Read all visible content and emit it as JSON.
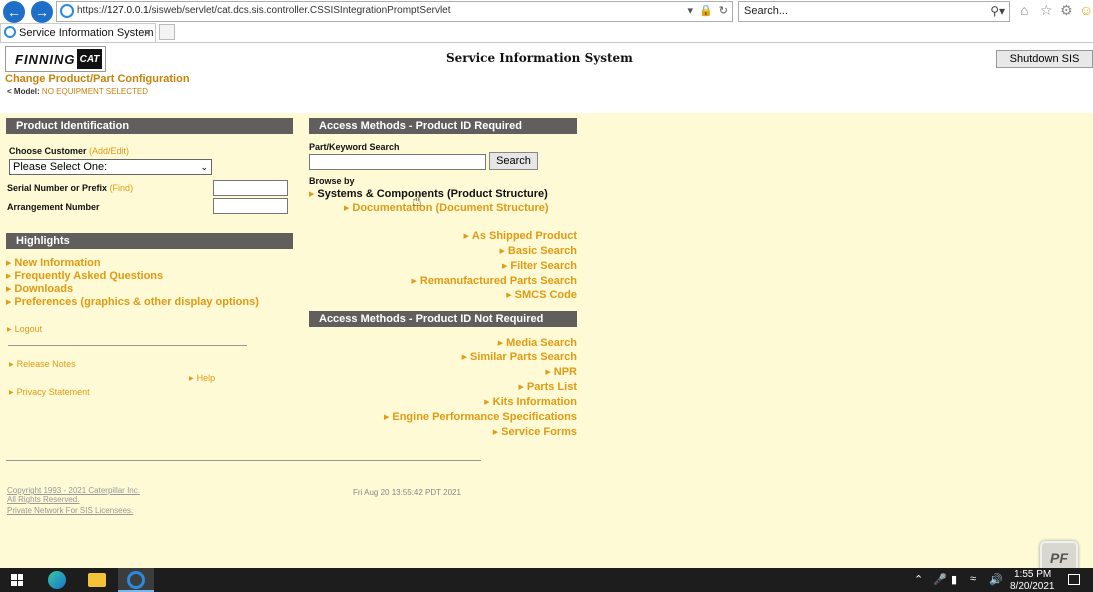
{
  "browser": {
    "url_prefix": "https://",
    "url_host": "127.0.0.1",
    "url_path": "/sisweb/servlet/cat.dcs.sis.controller.CSSISIntegrationPromptServlet",
    "search_placeholder": "Search...",
    "tab_title": "Service Information System",
    "tab_close": "×"
  },
  "header": {
    "logo_text": "FINNING",
    "logo_badge": "CAT",
    "title": "Service Information System",
    "shutdown_label": "Shutdown SIS",
    "change_product": "Change Product/Part Configuration",
    "model_key": "Model:",
    "model_value": "NO EQUIPMENT SELECTED"
  },
  "product_identification": {
    "heading": "Product Identification",
    "choose_customer": "Choose Customer",
    "add_edit": "(Add/Edit)",
    "customer_selected": "Please Select One:",
    "serial_label": "Serial Number or Prefix",
    "find": "(Find)",
    "arrangement_label": "Arrangement Number"
  },
  "highlights": {
    "heading": "Highlights",
    "items": [
      "New Information",
      "Frequently Asked Questions",
      "Downloads",
      "Preferences (graphics & other display options)"
    ],
    "logout": "Logout",
    "release_notes": "Release Notes",
    "help": "Help",
    "privacy": "Privacy Statement"
  },
  "access_required": {
    "heading": "Access Methods - Product ID Required",
    "pk_label": "Part/Keyword Search",
    "search_button": "Search",
    "browse_by": "Browse by",
    "systems": "Systems & Components (Product Structure)",
    "documentation": "Documentation (Document Structure)",
    "links": [
      "As Shipped Product",
      "Basic Search",
      "Filter Search",
      "Remanufactured Parts Search",
      "SMCS Code"
    ]
  },
  "access_not_required": {
    "heading": "Access Methods - Product ID Not Required",
    "links": [
      "Media Search",
      "Similar Parts Search",
      "NPR",
      "Parts List",
      "Kits Information",
      "Engine Performance Specifications",
      "Service Forms"
    ]
  },
  "footer": {
    "copyright": "Copyright 1993 - 2021 Caterpillar Inc.",
    "rights": "All Rights Reserved.",
    "private": "Private Network For SIS Licensees.",
    "date": "Fri Aug 20 13:55:42 PDT 2021"
  },
  "taskbar": {
    "time": "1:55 PM",
    "date": "8/20/2021"
  },
  "colors": {
    "accent_orange": "#e09a14",
    "bar_gray": "#625e5e",
    "page_bg": "#fdfad5"
  }
}
